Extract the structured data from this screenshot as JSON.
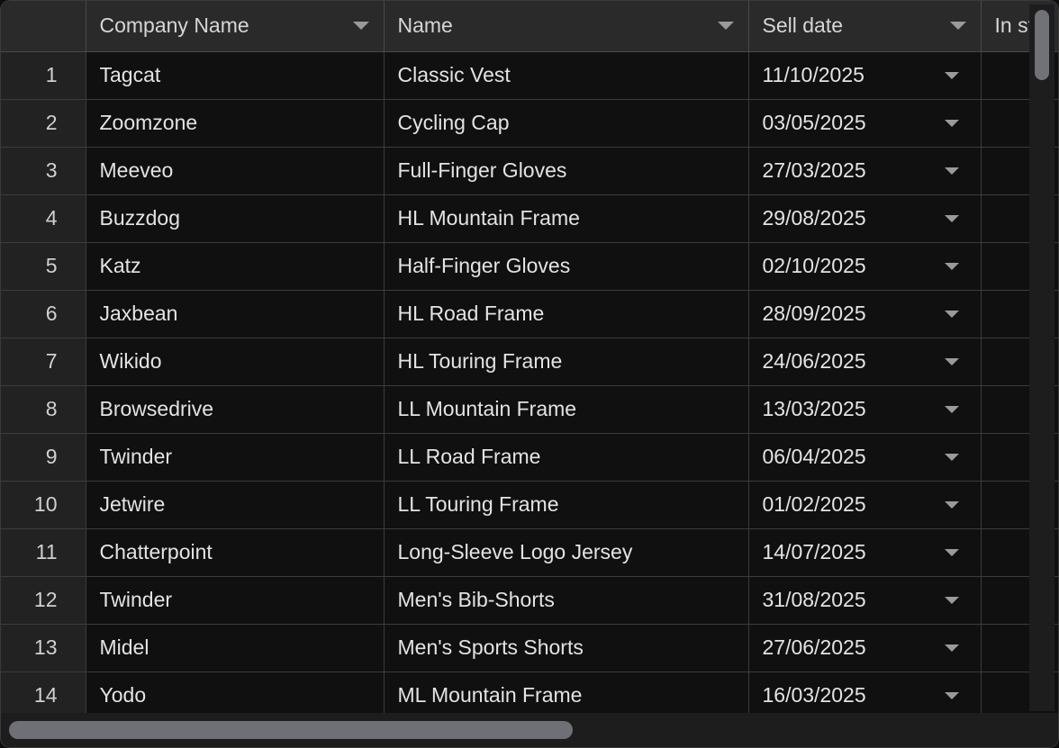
{
  "grid": {
    "columns": [
      {
        "key": "rownum",
        "label": "",
        "has_filter": false,
        "truncated": false
      },
      {
        "key": "company",
        "label": "Company Name",
        "has_filter": true,
        "truncated": false
      },
      {
        "key": "name",
        "label": "Name",
        "has_filter": true,
        "truncated": false
      },
      {
        "key": "date",
        "label": "Sell date",
        "has_filter": true,
        "truncated": false
      },
      {
        "key": "stock",
        "label": "In st",
        "has_filter": false,
        "truncated": true
      }
    ],
    "rows": [
      {
        "num": "1",
        "company": "Tagcat",
        "name": "Classic Vest",
        "date": "11/10/2025",
        "stock": ""
      },
      {
        "num": "2",
        "company": "Zoomzone",
        "name": "Cycling Cap",
        "date": "03/05/2025",
        "stock": ""
      },
      {
        "num": "3",
        "company": "Meeveo",
        "name": "Full-Finger Gloves",
        "date": "27/03/2025",
        "stock": ""
      },
      {
        "num": "4",
        "company": "Buzzdog",
        "name": "HL Mountain Frame",
        "date": "29/08/2025",
        "stock": ""
      },
      {
        "num": "5",
        "company": "Katz",
        "name": "Half-Finger Gloves",
        "date": "02/10/2025",
        "stock": ""
      },
      {
        "num": "6",
        "company": "Jaxbean",
        "name": "HL Road Frame",
        "date": "28/09/2025",
        "stock": ""
      },
      {
        "num": "7",
        "company": "Wikido",
        "name": "HL Touring Frame",
        "date": "24/06/2025",
        "stock": ""
      },
      {
        "num": "8",
        "company": "Browsedrive",
        "name": "LL Mountain Frame",
        "date": "13/03/2025",
        "stock": ""
      },
      {
        "num": "9",
        "company": "Twinder",
        "name": "LL Road Frame",
        "date": "06/04/2025",
        "stock": ""
      },
      {
        "num": "10",
        "company": "Jetwire",
        "name": "LL Touring Frame",
        "date": "01/02/2025",
        "stock": ""
      },
      {
        "num": "11",
        "company": "Chatterpoint",
        "name": "Long-Sleeve Logo Jersey",
        "date": "14/07/2025",
        "stock": ""
      },
      {
        "num": "12",
        "company": "Twinder",
        "name": "Men's Bib-Shorts",
        "date": "31/08/2025",
        "stock": ""
      },
      {
        "num": "13",
        "company": "Midel",
        "name": "Men's Sports Shorts",
        "date": "27/06/2025",
        "stock": ""
      },
      {
        "num": "14",
        "company": "Yodo",
        "name": "ML Mountain Frame",
        "date": "16/03/2025",
        "stock": ""
      }
    ]
  },
  "scrollbars": {
    "vertical": {
      "thumb_top_pct": 1,
      "thumb_height_pct": 10
    },
    "horizontal": {
      "thumb_left_pct": 1,
      "thumb_width_pct": 54
    }
  },
  "colors": {
    "window_bg": "#1d1d1d",
    "header_bg": "#2a2a2a",
    "cell_bg": "#101010",
    "rownum_bg": "#222222",
    "text": "#e3e3e3",
    "header_text": "#d6d6d6",
    "grid_line": "#3c3c3c",
    "header_line": "#4a4a4a",
    "scroll_thumb": "#6e7075",
    "caret": "#9a9a9a"
  }
}
